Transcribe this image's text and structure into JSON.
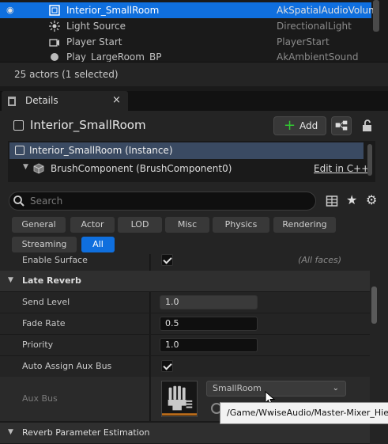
{
  "outliner": {
    "rows": [
      {
        "name": "Interior_SmallRoom",
        "type": "AkSpatialAudioVolum",
        "icon": "box-icon",
        "selected": true
      },
      {
        "name": "Light Source",
        "type": "DirectionalLight",
        "icon": "sun-icon"
      },
      {
        "name": "Player Start",
        "type": "PlayerStart",
        "icon": "player-start-icon"
      },
      {
        "name": "Play_LargeRoom_BP",
        "type": "AkAmbientSound",
        "icon": "sphere-icon"
      }
    ],
    "count_text": "25 actors (1 selected)"
  },
  "details": {
    "tab_label": "Details",
    "close_glyph": "×",
    "title": "Interior_SmallRoom",
    "add_label": "Add",
    "add_glyph": "+",
    "components": [
      {
        "label": "Interior_SmallRoom (Instance)"
      },
      {
        "label": "BrushComponent (BrushComponent0)"
      }
    ],
    "edit_cpp_label": "Edit in C++",
    "search_placeholder": "Search",
    "categories": [
      "General",
      "Actor",
      "LOD",
      "Misc",
      "Physics",
      "Rendering",
      "Streaming",
      "All"
    ],
    "active_category": "All"
  },
  "properties": {
    "enable_surface_label": "Enable Surface",
    "enable_surface_value": "(All faces)",
    "late_reverb_section": "Late Reverb",
    "send_level_label": "Send Level",
    "send_level_value": "1.0",
    "fade_rate_label": "Fade Rate",
    "fade_rate_value": "0.5",
    "priority_label": "Priority",
    "priority_value": "1.0",
    "auto_assign_label": "Auto Assign Aux Bus",
    "auto_assign_checked": true,
    "aux_bus_label": "Aux Bus",
    "aux_bus_value": "SmallRoom",
    "reverb_param_section": "Reverb Parameter Estimation"
  },
  "tooltip": {
    "text": "/Game/WwiseAudio/Master-Mixer_Hie"
  },
  "colors": {
    "selection": "#0f6fde",
    "panel": "#242424",
    "accent_green": "#32c832"
  }
}
